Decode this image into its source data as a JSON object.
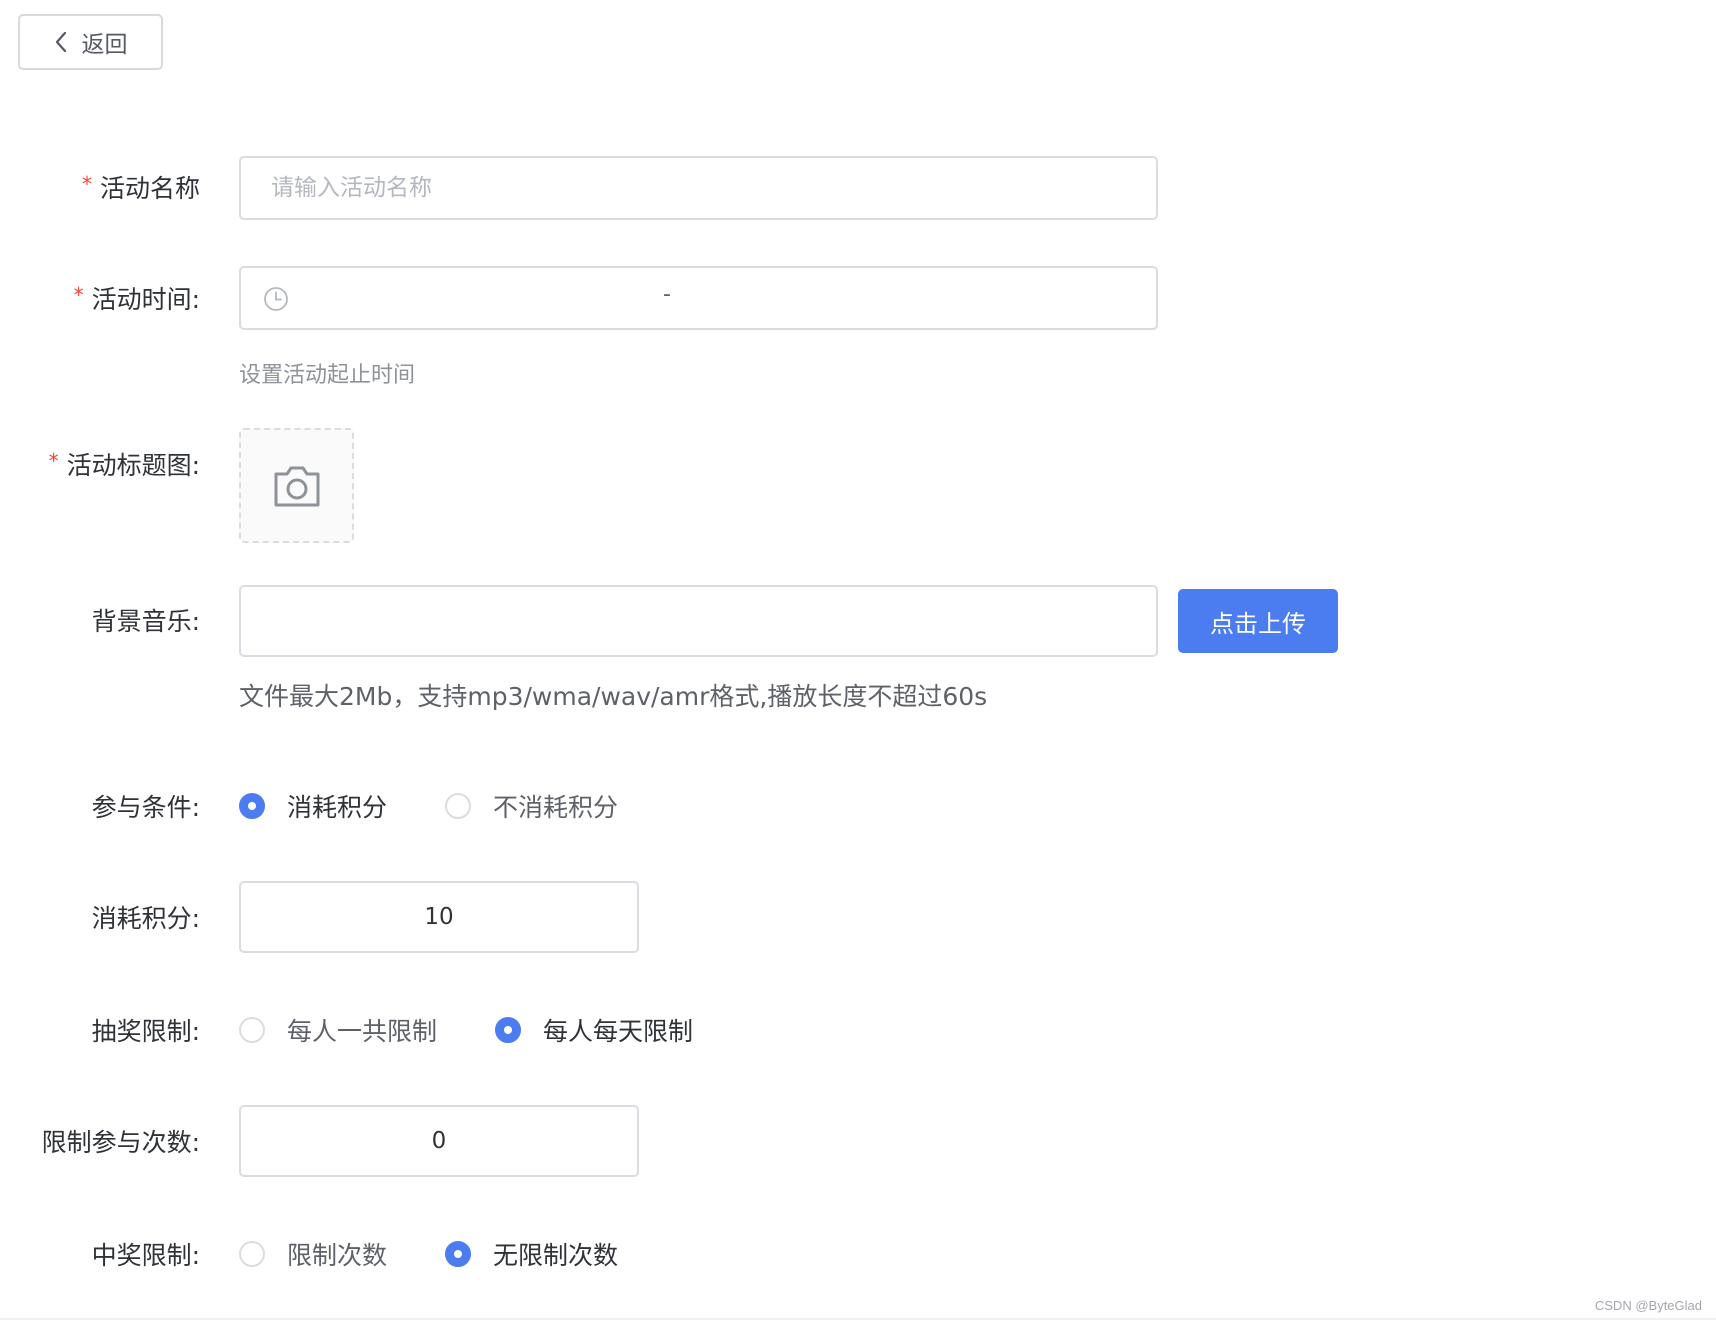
{
  "back_button": {
    "label": "返回",
    "icon": "chevron-left-icon"
  },
  "form": {
    "activity_name": {
      "label": "活动名称",
      "required": true,
      "placeholder": "请输入活动名称",
      "value": ""
    },
    "activity_time": {
      "label": "活动时间:",
      "required": true,
      "separator": "-",
      "icon": "clock-icon",
      "hint": "设置活动起止时间"
    },
    "title_image": {
      "label": "活动标题图:",
      "required": true,
      "icon": "camera-icon"
    },
    "background_music": {
      "label": "背景音乐:",
      "value": "",
      "upload_button": "点击上传",
      "hint": "文件最大2Mb，支持mp3/wma/wav/amr格式,播放长度不超过60s"
    },
    "participation": {
      "label": "参与条件:",
      "options": [
        "消耗积分",
        "不消耗积分"
      ],
      "selected": "消耗积分"
    },
    "points_cost": {
      "label": "消耗积分:",
      "value": "10"
    },
    "draw_limit": {
      "label": "抽奖限制:",
      "options": [
        "每人一共限制",
        "每人每天限制"
      ],
      "selected": "每人每天限制"
    },
    "participation_limit": {
      "label": "限制参与次数:",
      "value": "0"
    },
    "prize_limit": {
      "label": "中奖限制:",
      "options": [
        "限制次数",
        "无限制次数"
      ],
      "selected": "无限制次数"
    }
  },
  "colors": {
    "primary": "#4b7cf0",
    "required": "#f0453a",
    "border": "#d9dce1"
  },
  "watermark": "CSDN @ByteGlad"
}
